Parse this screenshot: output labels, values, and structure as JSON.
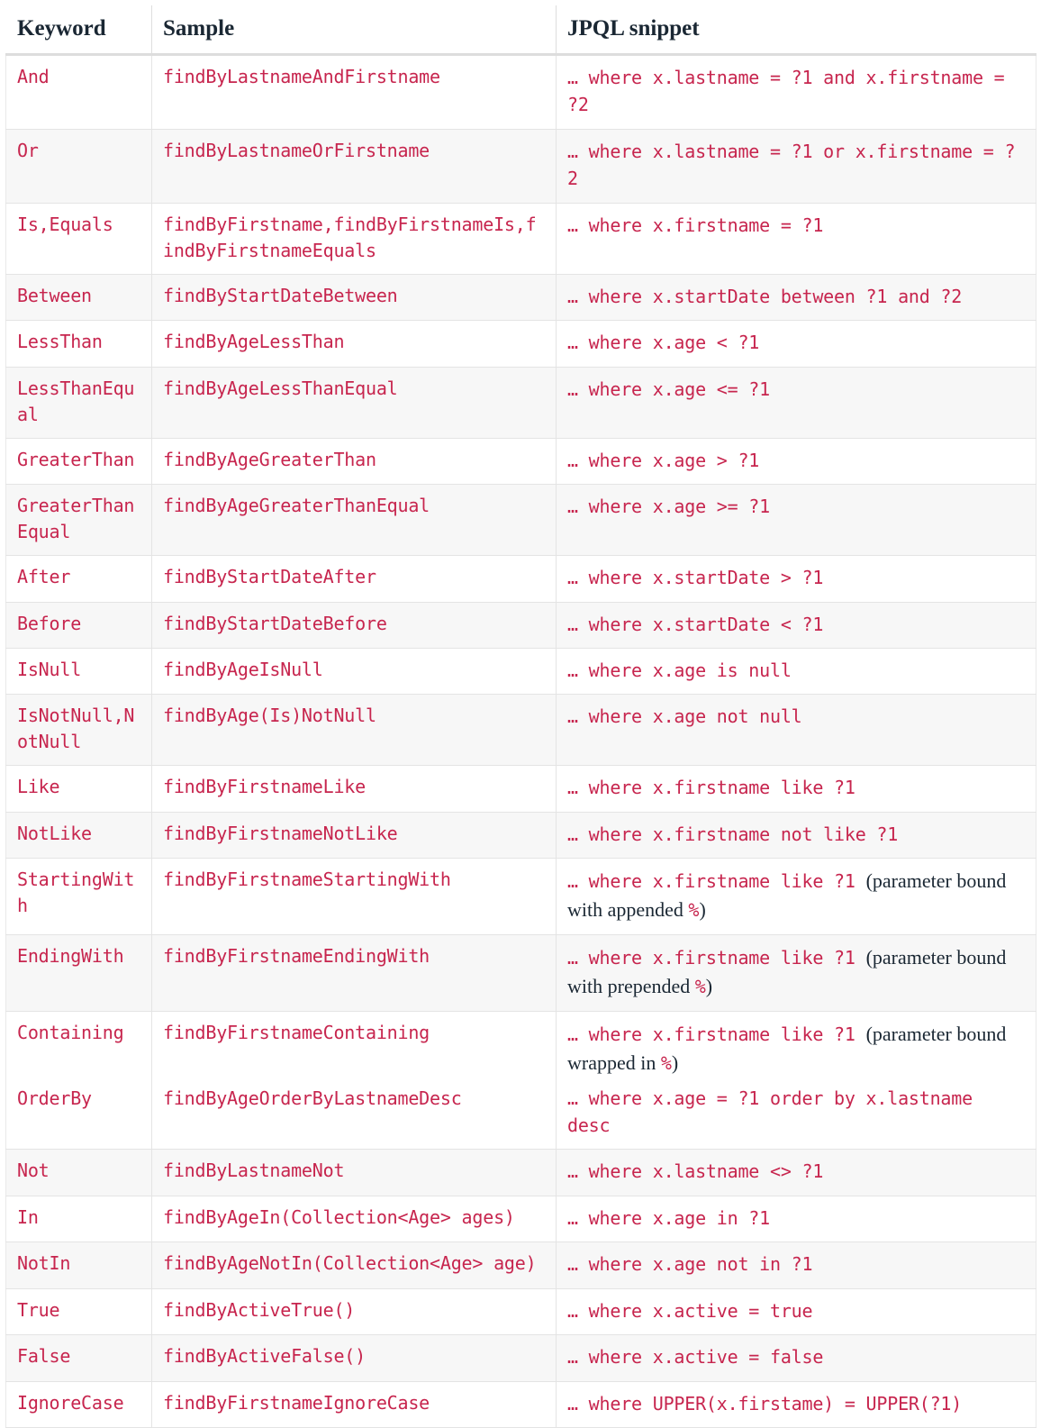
{
  "table": {
    "columns": [
      "Keyword",
      "Sample",
      "JPQL snippet"
    ],
    "rows": [
      {
        "keyword": "And",
        "sample": "findByLastnameAndFirstname",
        "jpql": "… where x.lastname = ?1 and x.firstname = ?2"
      },
      {
        "keyword": "Or",
        "sample": "findByLastnameOrFirstname",
        "jpql": "… where x.lastname = ?1 or x.firstname = ?2"
      },
      {
        "keyword": "Is,Equals",
        "sample": "findByFirstname,findByFirstnameIs,findByFirstnameEquals",
        "jpql": "… where x.firstname = ?1"
      },
      {
        "keyword": "Between",
        "sample": "findByStartDateBetween",
        "jpql": "… where x.startDate between ?1 and ?2"
      },
      {
        "keyword": "LessThan",
        "sample": "findByAgeLessThan",
        "jpql": "… where x.age < ?1"
      },
      {
        "keyword": "LessThanEqual",
        "sample": "findByAgeLessThanEqual",
        "jpql": "… where x.age <= ?1"
      },
      {
        "keyword": "GreaterThan",
        "sample": "findByAgeGreaterThan",
        "jpql": "… where x.age > ?1"
      },
      {
        "keyword": "GreaterThanEqual",
        "sample": "findByAgeGreaterThanEqual",
        "jpql": "… where x.age >= ?1"
      },
      {
        "keyword": "After",
        "sample": "findByStartDateAfter",
        "jpql": "… where x.startDate > ?1"
      },
      {
        "keyword": "Before",
        "sample": "findByStartDateBefore",
        "jpql": "… where x.startDate < ?1"
      },
      {
        "keyword": "IsNull",
        "sample": "findByAgeIsNull",
        "jpql": "… where x.age is null"
      },
      {
        "keyword": "IsNotNull,NotNull",
        "sample": "findByAge(Is)NotNull",
        "jpql": "… where x.age not null"
      },
      {
        "keyword": "Like",
        "sample": "findByFirstnameLike",
        "jpql": "… where x.firstname like ?1"
      },
      {
        "keyword": "NotLike",
        "sample": "findByFirstnameNotLike",
        "jpql": "… where x.firstname not like ?1"
      },
      {
        "keyword": "StartingWith",
        "sample": "findByFirstnameStartingWith",
        "jpql": "… where x.firstname like ?1 ",
        "jpql_note_open": "(parameter bound with appended ",
        "jpql_note_pct": "%",
        "jpql_note_close": ")"
      },
      {
        "keyword": "EndingWith",
        "sample": "findByFirstnameEndingWith",
        "jpql": "… where x.firstname like ?1 ",
        "jpql_note_open": "(parameter bound with prepended ",
        "jpql_note_pct": "%",
        "jpql_note_close": ")"
      },
      {
        "keyword_a": "Containing",
        "keyword_b": "OrderBy",
        "sample_a": "findByFirstnameContaining",
        "sample_b": "findByAgeOrderByLastnameDesc",
        "jpql_a": "… where x.firstname like ?1 ",
        "jpql_a_note_open": "(parameter bound wrapped in ",
        "jpql_a_note_pct": "%",
        "jpql_a_note_close": ")",
        "jpql_b": "… where x.age = ?1 order by x.lastname desc"
      },
      {
        "keyword": "Not",
        "sample": "findByLastnameNot",
        "jpql": "… where x.lastname <> ?1"
      },
      {
        "keyword": "In",
        "sample": "findByAgeIn(Collection<Age> ages)",
        "jpql": "… where x.age in ?1"
      },
      {
        "keyword": "NotIn",
        "sample": "findByAgeNotIn(Collection<Age> age)",
        "jpql": "… where x.age not in ?1"
      },
      {
        "keyword": "True",
        "sample": "findByActiveTrue()",
        "jpql": "… where x.active = true"
      },
      {
        "keyword": "False",
        "sample": "findByActiveFalse()",
        "jpql": "… where x.active = false"
      },
      {
        "keyword": "IgnoreCase",
        "sample": "findByFirstnameIgnoreCase",
        "jpql": "… where UPPER(x.firstame) = UPPER(?1)"
      }
    ]
  },
  "colors": {
    "code_red": "#c7254e",
    "header_text": "#1a2733",
    "row_stripe": "#f7f7f7",
    "border": "#e4e4e4",
    "header_rule": "#dddddd"
  }
}
